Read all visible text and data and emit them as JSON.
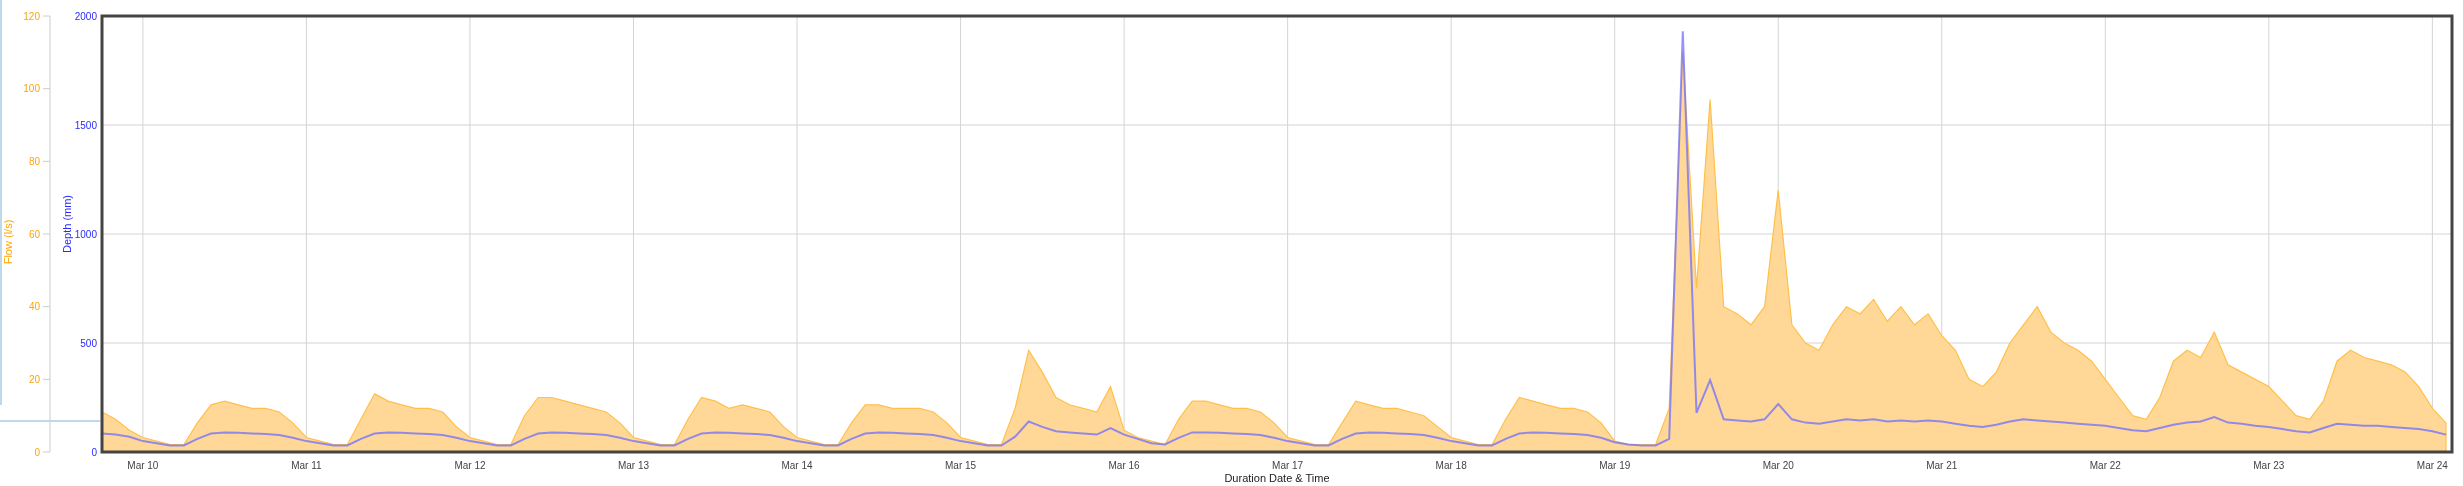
{
  "chart": {
    "chart_data": {
      "type": "area",
      "xlabel": "Duration Date & Time",
      "ylabel": "Flow (l/s)",
      "y2label": "Depth (mm)",
      "grid": true,
      "ylim": [
        0,
        120
      ],
      "y2lim": [
        0,
        2000
      ],
      "yticks": [
        0,
        20,
        40,
        60,
        80,
        100,
        120
      ],
      "y2ticks": [
        0,
        500,
        1000,
        1500,
        2000
      ],
      "categories": [
        null,
        null,
        null,
        "Mar 10",
        null,
        null,
        null,
        null,
        null,
        null,
        null,
        null,
        null,
        null,
        null,
        "Mar 11",
        null,
        null,
        null,
        null,
        null,
        null,
        null,
        null,
        null,
        null,
        null,
        "Mar 12",
        null,
        null,
        null,
        null,
        null,
        null,
        null,
        null,
        null,
        null,
        null,
        "Mar 13",
        null,
        null,
        null,
        null,
        null,
        null,
        null,
        null,
        null,
        null,
        null,
        "Mar 14",
        null,
        null,
        null,
        null,
        null,
        null,
        null,
        null,
        null,
        null,
        null,
        "Mar 15",
        null,
        null,
        null,
        null,
        null,
        null,
        null,
        null,
        null,
        null,
        null,
        "Mar 16",
        null,
        null,
        null,
        null,
        null,
        null,
        null,
        null,
        null,
        null,
        null,
        "Mar 17",
        null,
        null,
        null,
        null,
        null,
        null,
        null,
        null,
        null,
        null,
        null,
        "Mar 18",
        null,
        null,
        null,
        null,
        null,
        null,
        null,
        null,
        null,
        null,
        null,
        "Mar 19",
        null,
        null,
        null,
        null,
        null,
        null,
        null,
        null,
        null,
        null,
        null,
        "Mar 20",
        null,
        null,
        null,
        null,
        null,
        null,
        null,
        null,
        null,
        null,
        null,
        "Mar 21",
        null,
        null,
        null,
        null,
        null,
        null,
        null,
        null,
        null,
        null,
        null,
        "Mar 22",
        null,
        null,
        null,
        null,
        null,
        null,
        null,
        null,
        null,
        null,
        null,
        "Mar 23",
        null,
        null,
        null,
        null,
        null,
        null,
        null,
        null,
        null,
        null,
        null,
        "Mar 24",
        null
      ],
      "series": [
        {
          "type": "area",
          "color": "#ffc04a",
          "values": [
            11,
            9,
            6,
            4,
            3,
            2,
            2,
            8,
            13,
            14,
            13,
            12,
            12,
            11,
            8,
            4,
            3,
            2,
            2,
            9,
            16,
            14,
            13,
            12,
            12,
            11,
            7,
            4,
            3,
            2,
            2,
            10,
            15,
            15,
            14,
            13,
            12,
            11,
            8,
            4,
            3,
            2,
            2,
            9,
            15,
            14,
            12,
            13,
            12,
            11,
            7,
            4,
            3,
            2,
            2,
            8,
            13,
            13,
            12,
            12,
            12,
            11,
            8,
            4,
            3,
            2,
            2,
            12,
            28,
            22,
            15,
            13,
            12,
            11,
            18,
            6,
            4,
            3,
            2,
            9,
            14,
            14,
            13,
            12,
            12,
            11,
            8,
            4,
            3,
            2,
            2,
            8,
            14,
            13,
            12,
            12,
            11,
            10,
            7,
            4,
            3,
            2,
            2,
            9,
            15,
            14,
            13,
            12,
            12,
            11,
            8,
            3,
            2,
            2,
            2,
            12,
            110,
            45,
            97,
            40,
            38,
            35,
            40,
            72,
            35,
            30,
            28,
            35,
            40,
            38,
            42,
            36,
            40,
            35,
            38,
            32,
            28,
            20,
            18,
            22,
            30,
            35,
            40,
            33,
            30,
            28,
            25,
            20,
            15,
            10,
            9,
            15,
            25,
            28,
            26,
            33,
            24,
            22,
            20,
            18,
            14,
            10,
            9,
            14,
            25,
            28,
            26,
            25,
            24,
            22,
            18,
            12,
            8
          ]
        },
        {
          "type": "line",
          "color": "#6f6fff",
          "axis": "y2",
          "values": [
            85,
            80,
            70,
            50,
            40,
            30,
            30,
            60,
            85,
            90,
            88,
            85,
            82,
            78,
            65,
            50,
            40,
            30,
            30,
            60,
            85,
            90,
            88,
            85,
            82,
            78,
            65,
            50,
            40,
            30,
            30,
            60,
            85,
            90,
            88,
            85,
            82,
            78,
            65,
            50,
            40,
            30,
            30,
            60,
            85,
            90,
            88,
            85,
            82,
            78,
            65,
            50,
            40,
            30,
            30,
            60,
            85,
            90,
            88,
            85,
            82,
            78,
            65,
            50,
            40,
            30,
            30,
            70,
            140,
            115,
            95,
            90,
            85,
            80,
            110,
            80,
            60,
            40,
            35,
            65,
            90,
            90,
            88,
            85,
            82,
            78,
            65,
            50,
            40,
            30,
            30,
            60,
            85,
            90,
            88,
            85,
            82,
            78,
            65,
            50,
            40,
            30,
            30,
            60,
            85,
            90,
            88,
            85,
            82,
            78,
            65,
            45,
            35,
            30,
            30,
            60,
            1930,
            180,
            330,
            150,
            145,
            140,
            150,
            220,
            150,
            135,
            130,
            140,
            150,
            145,
            150,
            140,
            145,
            140,
            145,
            140,
            130,
            120,
            115,
            125,
            140,
            150,
            145,
            140,
            135,
            130,
            125,
            120,
            110,
            100,
            95,
            110,
            125,
            135,
            140,
            160,
            135,
            130,
            120,
            115,
            105,
            95,
            90,
            110,
            130,
            125,
            120,
            120,
            115,
            110,
            105,
            95,
            80
          ]
        }
      ]
    }
  }
}
